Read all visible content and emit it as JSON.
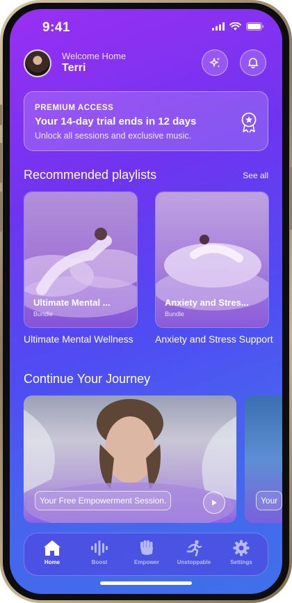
{
  "status": {
    "time": "9:41"
  },
  "header": {
    "welcome": "Welcome Home",
    "name": "Terri"
  },
  "premium": {
    "label": "PREMIUM ACCESS",
    "headline": "Your 14-day trial ends in 12 days",
    "subtext": "Unlock all sessions and exclusive music."
  },
  "playlists": {
    "title": "Recommended playlists",
    "see_all": "See all",
    "items": [
      {
        "overlay": "Ultimate Mental ...",
        "type": "Bundle",
        "title": "Ultimate Mental Wellness"
      },
      {
        "overlay": "Anxiety and Stres...",
        "type": "Bundle",
        "title": "Anxiety and Stress Support"
      }
    ]
  },
  "journey": {
    "title": "Continue Your Journey",
    "items": [
      {
        "label": "Your Free Empowerment Session."
      },
      {
        "label": "Your"
      }
    ]
  },
  "tabs": [
    {
      "label": "Home",
      "icon": "home-icon",
      "active": true
    },
    {
      "label": "Boost",
      "icon": "sound-wave-icon",
      "active": false
    },
    {
      "label": "Empower",
      "icon": "fist-icon",
      "active": false
    },
    {
      "label": "Unstoppable",
      "icon": "runner-icon",
      "active": false
    },
    {
      "label": "Settings",
      "icon": "gear-icon",
      "active": false
    }
  ]
}
